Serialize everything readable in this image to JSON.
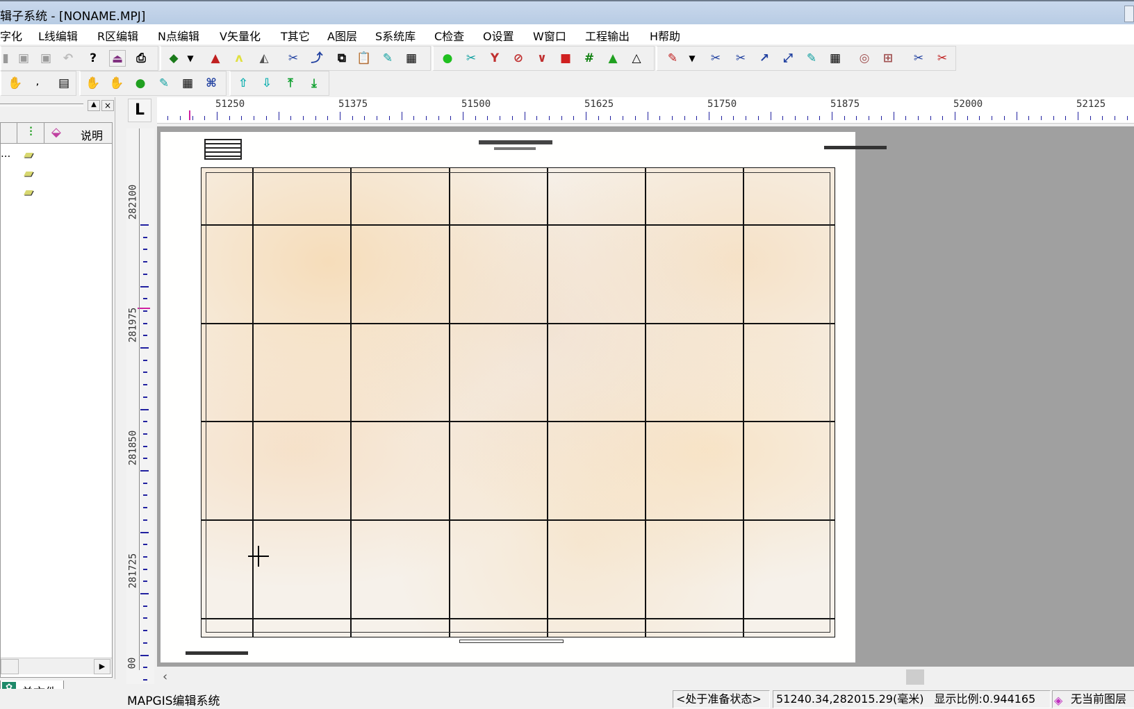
{
  "window": {
    "title": "…数字化系统 - [NONAME.MPJ]",
    "title_visible": "辑子系统 - [NONAME.MPJ]"
  },
  "menu": [
    {
      "label": "字化"
    },
    {
      "label": "L线编辑"
    },
    {
      "label": "R区编辑"
    },
    {
      "label": "N点编辑"
    },
    {
      "label": "V矢量化"
    },
    {
      "label": "T其它"
    },
    {
      "label": "A图层"
    },
    {
      "label": "S系统库"
    },
    {
      "label": "C检查"
    },
    {
      "label": "O设置"
    },
    {
      "label": "W窗口"
    },
    {
      "label": "工程输出"
    },
    {
      "label": "H帮助"
    }
  ],
  "left_panel": {
    "columns": [
      "",
      "说明"
    ],
    "rows": [
      {
        "name": "..."
      },
      {
        "name": ""
      },
      {
        "name": ""
      }
    ],
    "tab_label": "单文件"
  },
  "ruler": {
    "corner": "L",
    "x_labels": [
      "51250",
      "51375",
      "51500",
      "51625",
      "51750",
      "51875",
      "52000",
      "52125"
    ],
    "y_labels": [
      "282100",
      "281975",
      "281850",
      "281725",
      "00"
    ]
  },
  "status": {
    "app_name": "MAPGIS编辑系统",
    "state": "<处于准备状态>",
    "coords": "51240.34,282015.29(毫米)",
    "scale": "显示比例:0.944165",
    "layer": "无当前图层"
  },
  "colors": {
    "ruler_tick": "#2020a0",
    "ruler_cursor": "#d020a0",
    "canvas_bg": "#a0a0a0"
  }
}
